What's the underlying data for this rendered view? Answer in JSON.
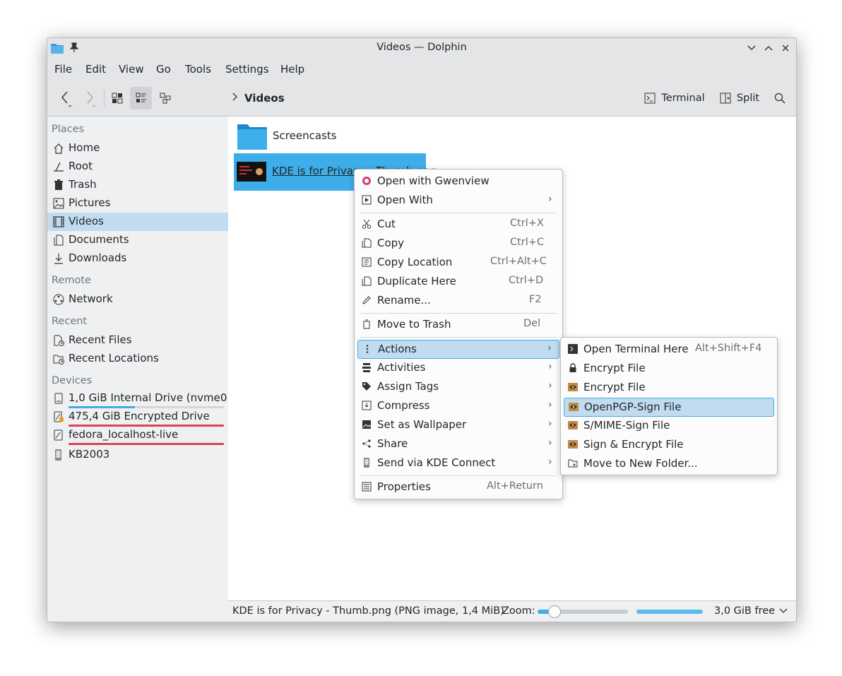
{
  "window": {
    "title": "Videos — Dolphin"
  },
  "menubar": [
    "File",
    "Edit",
    "Go",
    "Tools",
    "Settings",
    "Help",
    "View"
  ],
  "menu": {
    "file": "File",
    "edit": "Edit",
    "view": "View",
    "go": "Go",
    "tools": "Tools",
    "settings": "Settings",
    "help": "Help"
  },
  "toolbar": {
    "breadcrumb": "Videos",
    "terminal": "Terminal",
    "split": "Split"
  },
  "sidebar": {
    "places_header": "Places",
    "places": [
      "Home",
      "Root",
      "Trash",
      "Pictures",
      "Videos",
      "Documents",
      "Downloads"
    ],
    "remote_header": "Remote",
    "remote": [
      "Network"
    ],
    "recent_header": "Recent",
    "recent": [
      "Recent Files",
      "Recent Locations"
    ],
    "devices_header": "Devices",
    "devices": [
      "1,0 GiB Internal Drive (nvme0...",
      "475,4 GiB Encrypted Drive",
      "fedora_localhost-live",
      "KB2003"
    ],
    "selected": "Videos"
  },
  "files": [
    {
      "name": "Screencasts",
      "type": "folder"
    },
    {
      "name": "KDE is for Privacy - Thumb.png",
      "type": "image",
      "selected": true
    }
  ],
  "context_menu": {
    "items": [
      {
        "label": "Open with Gwenview",
        "icon": "gwenview-icon"
      },
      {
        "label": "Open With",
        "submenu": true,
        "icon": "open-with-icon"
      },
      {
        "label": "Cut",
        "shortcut": "Ctrl+X",
        "icon": "cut-icon"
      },
      {
        "label": "Copy",
        "shortcut": "Ctrl+C",
        "icon": "copy-icon"
      },
      {
        "label": "Copy Location",
        "shortcut": "Ctrl+Alt+C",
        "icon": "copy-location-icon"
      },
      {
        "label": "Duplicate Here",
        "shortcut": "Ctrl+D",
        "icon": "duplicate-icon"
      },
      {
        "label": "Rename...",
        "shortcut": "F2",
        "icon": "rename-icon"
      },
      {
        "label": "Move to Trash",
        "shortcut": "Del",
        "icon": "trash-icon"
      },
      {
        "label": "Actions",
        "submenu": true,
        "highlighted": true,
        "icon": "actions-icon"
      },
      {
        "label": "Activities",
        "submenu": true,
        "icon": "activities-icon"
      },
      {
        "label": "Assign Tags",
        "submenu": true,
        "icon": "tag-icon"
      },
      {
        "label": "Compress",
        "submenu": true,
        "icon": "compress-icon"
      },
      {
        "label": "Set as Wallpaper",
        "submenu": true,
        "icon": "wallpaper-icon"
      },
      {
        "label": "Share",
        "submenu": true,
        "icon": "share-icon"
      },
      {
        "label": "Send via KDE Connect",
        "submenu": true,
        "icon": "kdeconnect-icon"
      },
      {
        "label": "Properties",
        "shortcut": "Alt+Return",
        "icon": "properties-icon"
      }
    ]
  },
  "actions_submenu": {
    "items": [
      {
        "label": "Open Terminal Here",
        "shortcut": "Alt+Shift+F4",
        "icon": "terminal-icon"
      },
      {
        "label": "Encrypt File",
        "icon": "lock-icon"
      },
      {
        "label": "Encrypt File",
        "icon": "kleopatra-icon"
      },
      {
        "label": "OpenPGP-Sign File",
        "icon": "kleopatra-icon",
        "highlighted": true
      },
      {
        "label": "S/MIME-Sign File",
        "icon": "kleopatra-icon"
      },
      {
        "label": "Sign & Encrypt File",
        "icon": "kleopatra-icon"
      },
      {
        "label": "Move to New Folder...",
        "icon": "new-folder-icon"
      }
    ]
  },
  "statusbar": {
    "info": "KDE is for Privacy - Thumb.png (PNG image, 1,4 MiB)",
    "zoom_label": "Zoom:",
    "zoom_level": 0.18,
    "free_space": "3,0 GiB free"
  },
  "colors": {
    "accent": "#3daee9",
    "selection": "#c1dcf0",
    "danger": "#da4453"
  }
}
